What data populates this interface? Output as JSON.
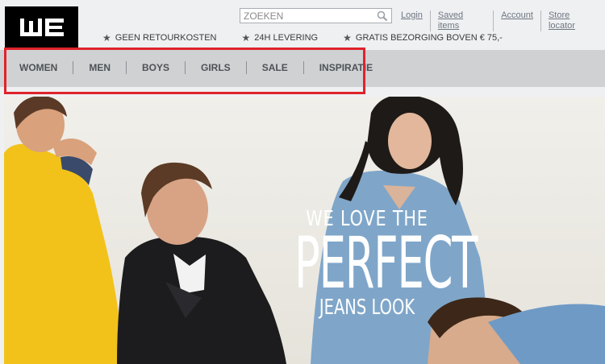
{
  "brand": {
    "logo_text": "WE"
  },
  "search": {
    "placeholder": "ZOEKEN"
  },
  "top_links": [
    "Login",
    "Saved items",
    "Account",
    "Store locator"
  ],
  "usps": [
    "GEEN RETOURKOSTEN",
    "24H LEVERING",
    "GRATIS BEZORGING BOVEN € 75,-"
  ],
  "nav": [
    "WOMEN",
    "MEN",
    "BOYS",
    "GIRLS",
    "SALE",
    "INSPIRATIE"
  ],
  "hero": {
    "line1": "WE LOVE THE",
    "line2": "PERFECT",
    "line3": "JEANS LOOK"
  },
  "colors": {
    "highlight": "#e0232a",
    "navbar": "#cfd1d3"
  }
}
